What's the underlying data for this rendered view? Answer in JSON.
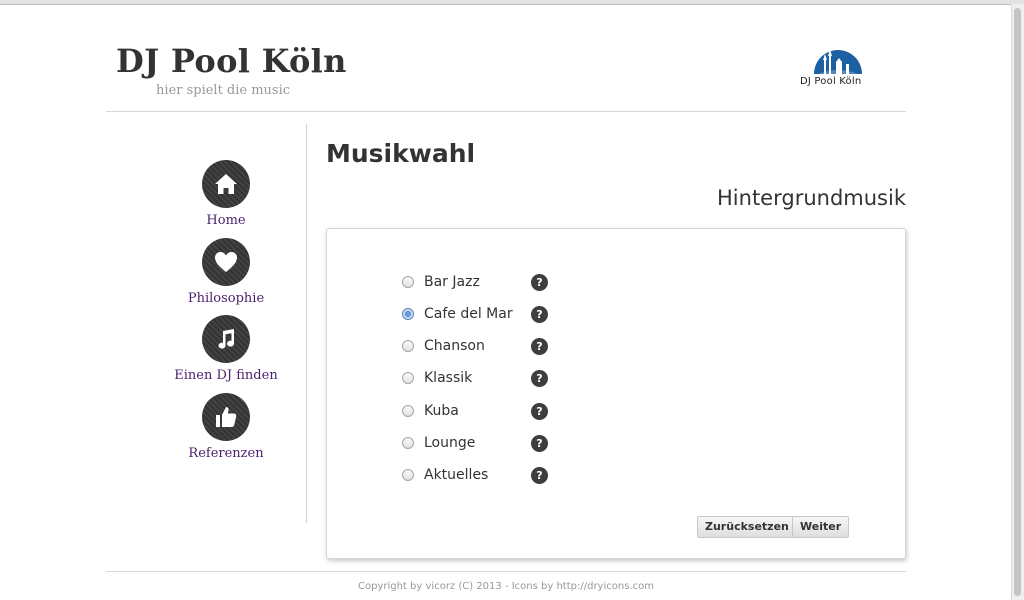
{
  "header": {
    "title": "DJ Pool Köln",
    "tagline": "hier spielt die music",
    "logo_text": "DJ Pool Köln"
  },
  "nav": {
    "items": [
      {
        "label": "Home",
        "icon": "home-icon"
      },
      {
        "label": "Philosophie",
        "icon": "heart-icon"
      },
      {
        "label": "Einen DJ finden",
        "icon": "music-note-icon"
      },
      {
        "label": "Referenzen",
        "icon": "thumbs-up-icon"
      }
    ]
  },
  "main": {
    "title": "Musikwahl",
    "section_title": "Hintergrundmusik",
    "help_symbol": "?",
    "options": [
      {
        "label": "Bar Jazz",
        "checked": false
      },
      {
        "label": "Cafe del Mar",
        "checked": true
      },
      {
        "label": "Chanson",
        "checked": false
      },
      {
        "label": "Klassik",
        "checked": false
      },
      {
        "label": "Kuba",
        "checked": false
      },
      {
        "label": "Lounge",
        "checked": false
      },
      {
        "label": "Aktuelles",
        "checked": false
      }
    ],
    "reset_label": "Zurücksetzen",
    "next_label": "Weiter"
  },
  "footer": {
    "text": "Copyright by vicorz (C) 2013 - Icons by http://dryicons.com"
  },
  "colors": {
    "logo_blue": "#1d5fa3",
    "nav_link": "#4a1f6d",
    "nav_circle": "#3a3a3a"
  }
}
